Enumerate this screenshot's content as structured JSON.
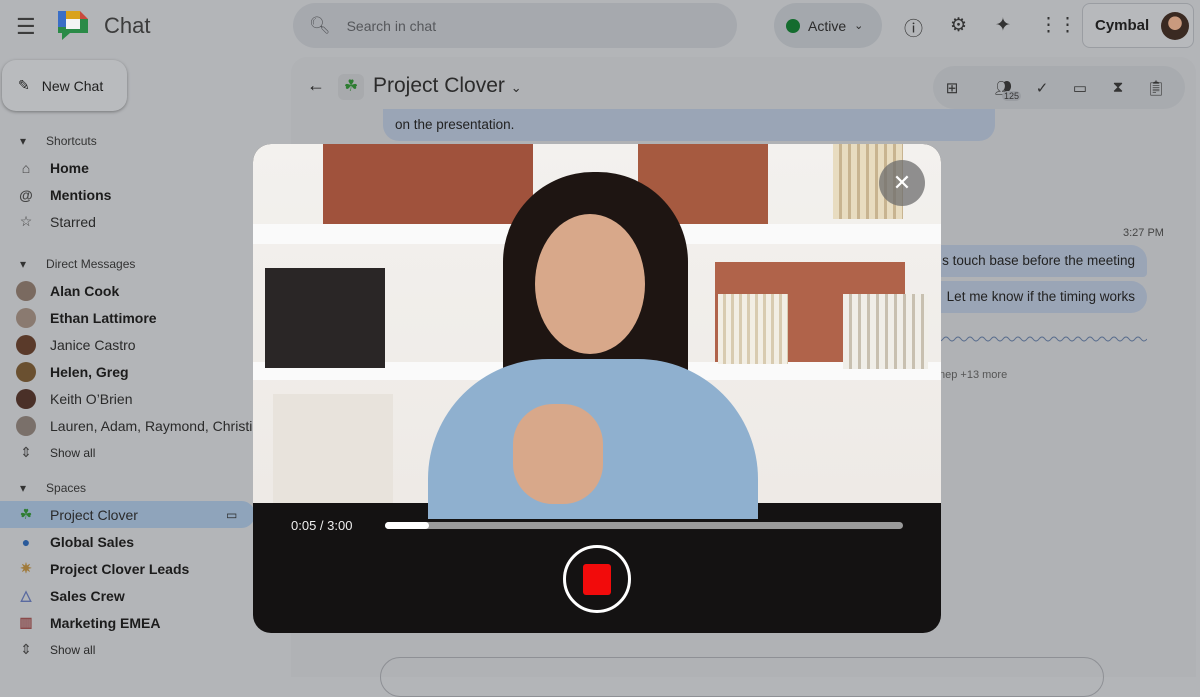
{
  "app": {
    "name": "Chat",
    "menu_icon": "hamburger-icon"
  },
  "search": {
    "placeholder": "Search in chat"
  },
  "status": {
    "label": "Active",
    "color": "#146c2e"
  },
  "top_icons": [
    "help-icon",
    "settings-icon",
    "gemini-icon",
    "apps-icon"
  ],
  "brand": {
    "name": "Cymbal"
  },
  "new_chat": {
    "label": "New Chat"
  },
  "sidebar": {
    "shortcuts": {
      "label": "Shortcuts",
      "items": [
        {
          "label": "Home",
          "bold": true
        },
        {
          "label": "Mentions",
          "bold": true
        },
        {
          "label": "Starred",
          "bold": false
        }
      ]
    },
    "dms": {
      "label": "Direct Messages",
      "items": [
        {
          "label": "Alan Cook",
          "bold": true
        },
        {
          "label": "Ethan Lattimore",
          "bold": true
        },
        {
          "label": "Janice Castro",
          "bold": false
        },
        {
          "label": "Helen, Greg",
          "bold": true
        },
        {
          "label": "Keith O’Brien",
          "bold": false
        },
        {
          "label": "Lauren, Adam, Raymond, Christian",
          "bold": false
        }
      ],
      "show_all": "Show all"
    },
    "spaces": {
      "label": "Spaces",
      "items": [
        {
          "label": "Project Clover",
          "selected": true
        },
        {
          "label": "Global Sales",
          "bold": true
        },
        {
          "label": "Project Clover Leads",
          "bold": true
        },
        {
          "label": "Sales Crew",
          "bold": true
        },
        {
          "label": "Marketing EMEA",
          "bold": true
        }
      ],
      "show_all": "Show all"
    }
  },
  "space": {
    "title": "Project Clover",
    "member_count": "125"
  },
  "messages": {
    "partial": "on the presentation.",
    "time": "3:27 PM",
    "bubble1": "s touch base before the meeting",
    "bubble2": "Let me know if the timing works",
    "reactions": "nep +13 more"
  },
  "recorder": {
    "time": "0:05 / 3:00",
    "progress_fraction": 0.085,
    "record_color": "#f20b0b"
  }
}
